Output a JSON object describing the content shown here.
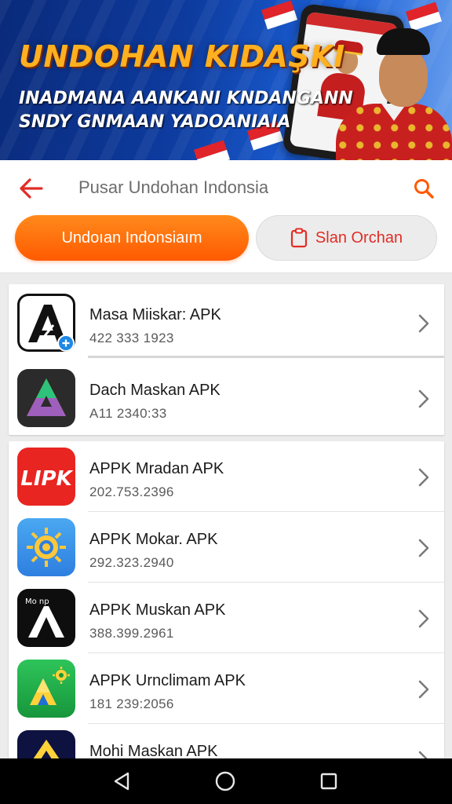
{
  "banner": {
    "title": "UNDOHAN KIDAŞKI",
    "subtitle_line1": "INADMANA AANKANI KNDANGANN",
    "subtitle_line2": "SNDY GNMAAN YADOANIAIA"
  },
  "search": {
    "text": "Pusar Undohan Indonsia"
  },
  "filters": {
    "primary_label": "Undoıan Indonsiaım",
    "secondary_label": "Slan Orchan"
  },
  "apps": [
    {
      "name": "Masa Miiskar: APK",
      "size": "422 333 1923"
    },
    {
      "name": "Dach Maskan APK",
      "size": "A11 2340:33"
    },
    {
      "name": "APPK Mradan APK",
      "size": "202.753.2396"
    },
    {
      "name": "APPK Mokar. APK",
      "size": "292.323.2940"
    },
    {
      "name": "APPK Muskan APK",
      "size": "388.399.2961"
    },
    {
      "name": "APPK Urnclimam APK",
      "size": "181 239:2056"
    },
    {
      "name": "Mohi Maskan APK",
      "size": ""
    }
  ],
  "icon_texts": {
    "app3": "LIPK",
    "app5": "Mo np"
  },
  "colors": {
    "accent_orange": "#ff6a0a",
    "accent_red": "#e12d26"
  }
}
